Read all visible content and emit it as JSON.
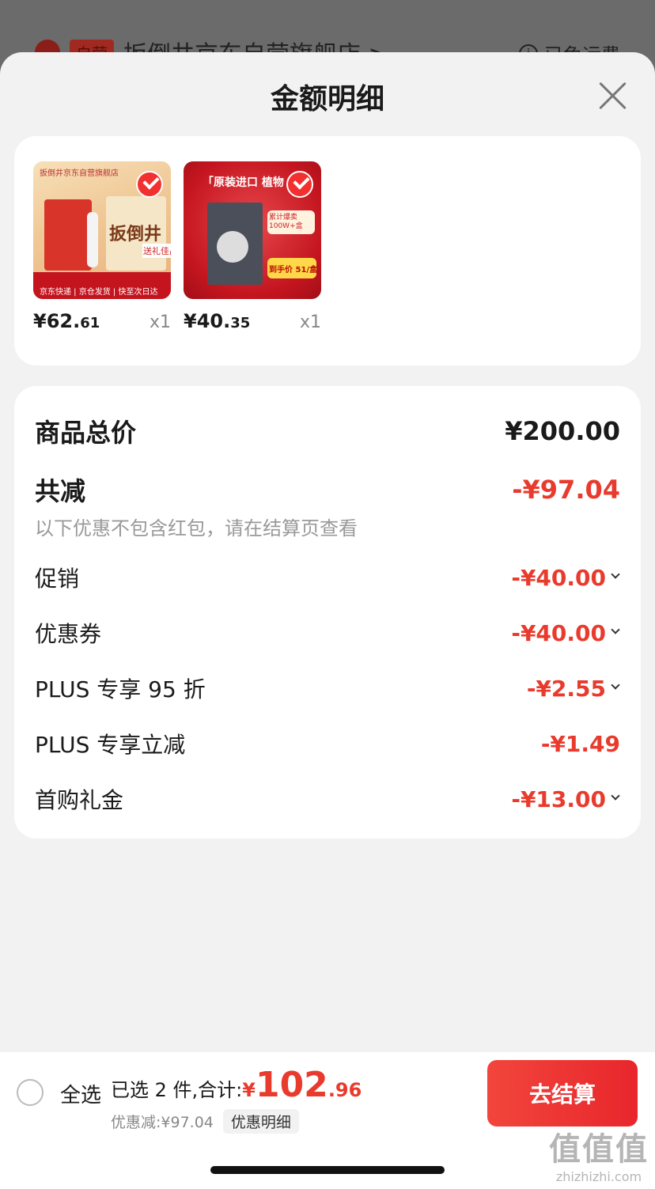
{
  "background": {
    "store_tag": "自营",
    "store_name": "扳倒井京东自营旗舰店 >",
    "shipping": "已免运费"
  },
  "sheet": {
    "title": "金额明细"
  },
  "products": [
    {
      "price_int": "¥62.",
      "price_dec": "61",
      "qty": "x1",
      "img_text_top": "扳倒井京东自营旗舰店",
      "img_brand": "扳倒井",
      "img_text_bottom": "京东快递 | 京仓发货 | 快至次日达",
      "img_tag": "送礼佳品"
    },
    {
      "price_int": "¥40.",
      "price_dec": "35",
      "qty": "x1",
      "img_text_top": "「原装进口 植物",
      "img_sales": "累计爆卖 100W+盒",
      "img_price": "到手价 51/盒"
    }
  ],
  "detail": {
    "total_label": "商品总价",
    "total_value": "¥200.00",
    "reduce_label": "共减",
    "reduce_value": "-¥97.04",
    "note": "以下优惠不包含红包，请在结算页查看",
    "items": [
      {
        "label": "促销",
        "value": "-¥40.00"
      },
      {
        "label": "优惠券",
        "value": "-¥40.00"
      },
      {
        "label": "PLUS 专享 95 折",
        "value": "-¥2.55"
      },
      {
        "label": "PLUS 专享立减",
        "value": "-¥1.49"
      },
      {
        "label": "首购礼金",
        "value": "-¥13.00"
      }
    ]
  },
  "bottom": {
    "select_all": "全选",
    "selected": "已选 2 件,合计:",
    "yen": "¥",
    "total_int": "102",
    "total_dec": ".96",
    "discount": "优惠减:¥97.04",
    "detail_btn": "优惠明细",
    "checkout": "去结算"
  },
  "watermark": {
    "big": "值值值",
    "small": "zhizhizhi.com"
  }
}
